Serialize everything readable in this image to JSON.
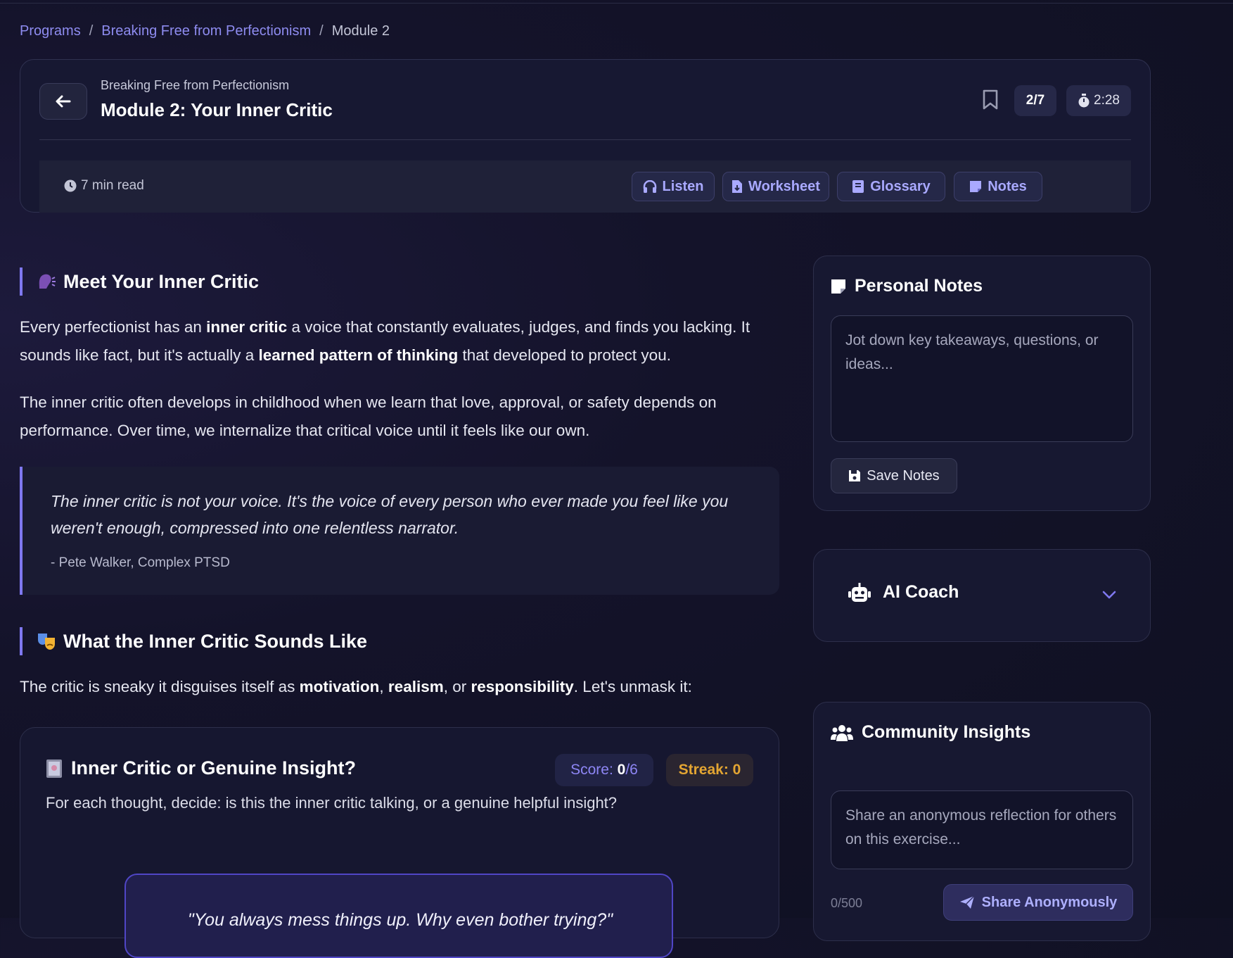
{
  "breadcrumb": {
    "items": [
      "Programs",
      "Breaking Free from Perfectionism"
    ],
    "separator": "/",
    "current": "Module 2"
  },
  "header": {
    "program": "Breaking Free from Perfectionism",
    "title": "Module 2: Your Inner Critic",
    "progress": "2/7",
    "timer": "2:28",
    "read_time": "7 min read",
    "tools": {
      "listen": "Listen",
      "worksheet": "Worksheet",
      "glossary": "Glossary",
      "notes": "Notes"
    }
  },
  "content": {
    "section1": {
      "icon": "speaking-head-icon",
      "title": "Meet Your Inner Critic",
      "p1": {
        "a": "Every perfectionist has an ",
        "b1": "inner critic",
        "c": " a voice that constantly evaluates, judges, and finds you lacking. It sounds like fact, but it's actually a ",
        "b2": "learned pattern of thinking",
        "d": " that developed to protect you."
      },
      "p2": "The inner critic often develops in childhood when we learn that love, approval, or safety depends on performance. Over time, we internalize that critical voice until it feels like our own."
    },
    "quote": {
      "text": "The inner critic is not your voice. It's the voice of every person who ever made you feel like you weren't enough, compressed into one relentless narrator.",
      "attribution": "- Pete Walker, Complex PTSD"
    },
    "section2": {
      "icon": "theater-masks-icon",
      "title": "What the Inner Critic Sounds Like",
      "p": {
        "a": "The critic is sneaky it disguises itself as ",
        "b1": "motivation",
        "c": ", ",
        "b2": "realism",
        "d": ", or ",
        "b3": "responsibility",
        "e": ". Let's unmask it:"
      }
    }
  },
  "quiz": {
    "title": "Inner Critic or Genuine Insight?",
    "score_label": "Score: ",
    "score": "0",
    "score_total": "/6",
    "streak_label": "Streak: ",
    "streak": "0",
    "description": "For each thought, decide: is this the inner critic talking, or a genuine helpful insight?",
    "thought": "\"You always mess things up. Why even bother trying?\""
  },
  "sidebar": {
    "notes": {
      "title": "Personal Notes",
      "placeholder": "Jot down key takeaways, questions, or ideas...",
      "save_label": "Save Notes"
    },
    "coach": {
      "title": "AI Coach"
    },
    "community": {
      "title": "Community Insights",
      "placeholder": "Share an anonymous reflection for others on this exercise...",
      "char_count": "0/500",
      "share_label": "Share Anonymously"
    }
  },
  "colors": {
    "accent": "#7f78f0",
    "link": "#8e8cf0",
    "streak": "#e3a532",
    "background": "#14132a"
  }
}
